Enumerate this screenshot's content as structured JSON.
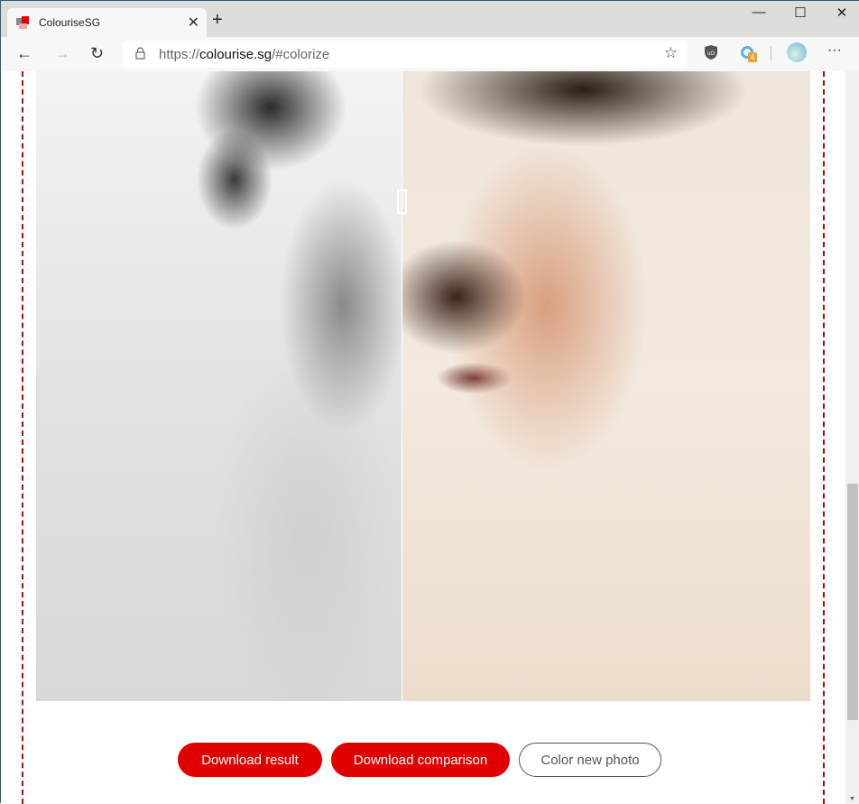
{
  "browser": {
    "tab_title": "ColouriseSG",
    "url_scheme": "https://",
    "url_host": "colourise.sg",
    "url_path": "/#colorize",
    "extension_badge": "4",
    "icons": [
      "back-icon",
      "forward-icon",
      "refresh-icon",
      "lock-icon",
      "star-icon",
      "ublock-icon",
      "extension-icon",
      "profile-avatar",
      "more-icon",
      "minimize-icon",
      "maximize-icon",
      "close-icon"
    ]
  },
  "compare": {
    "split_percent": 47
  },
  "actions": {
    "download_result": "Download result",
    "download_comparison": "Download comparison",
    "color_new_photo": "Color new photo"
  },
  "colors": {
    "accent": "#e10000",
    "dashed_border": "#b40a0a"
  }
}
